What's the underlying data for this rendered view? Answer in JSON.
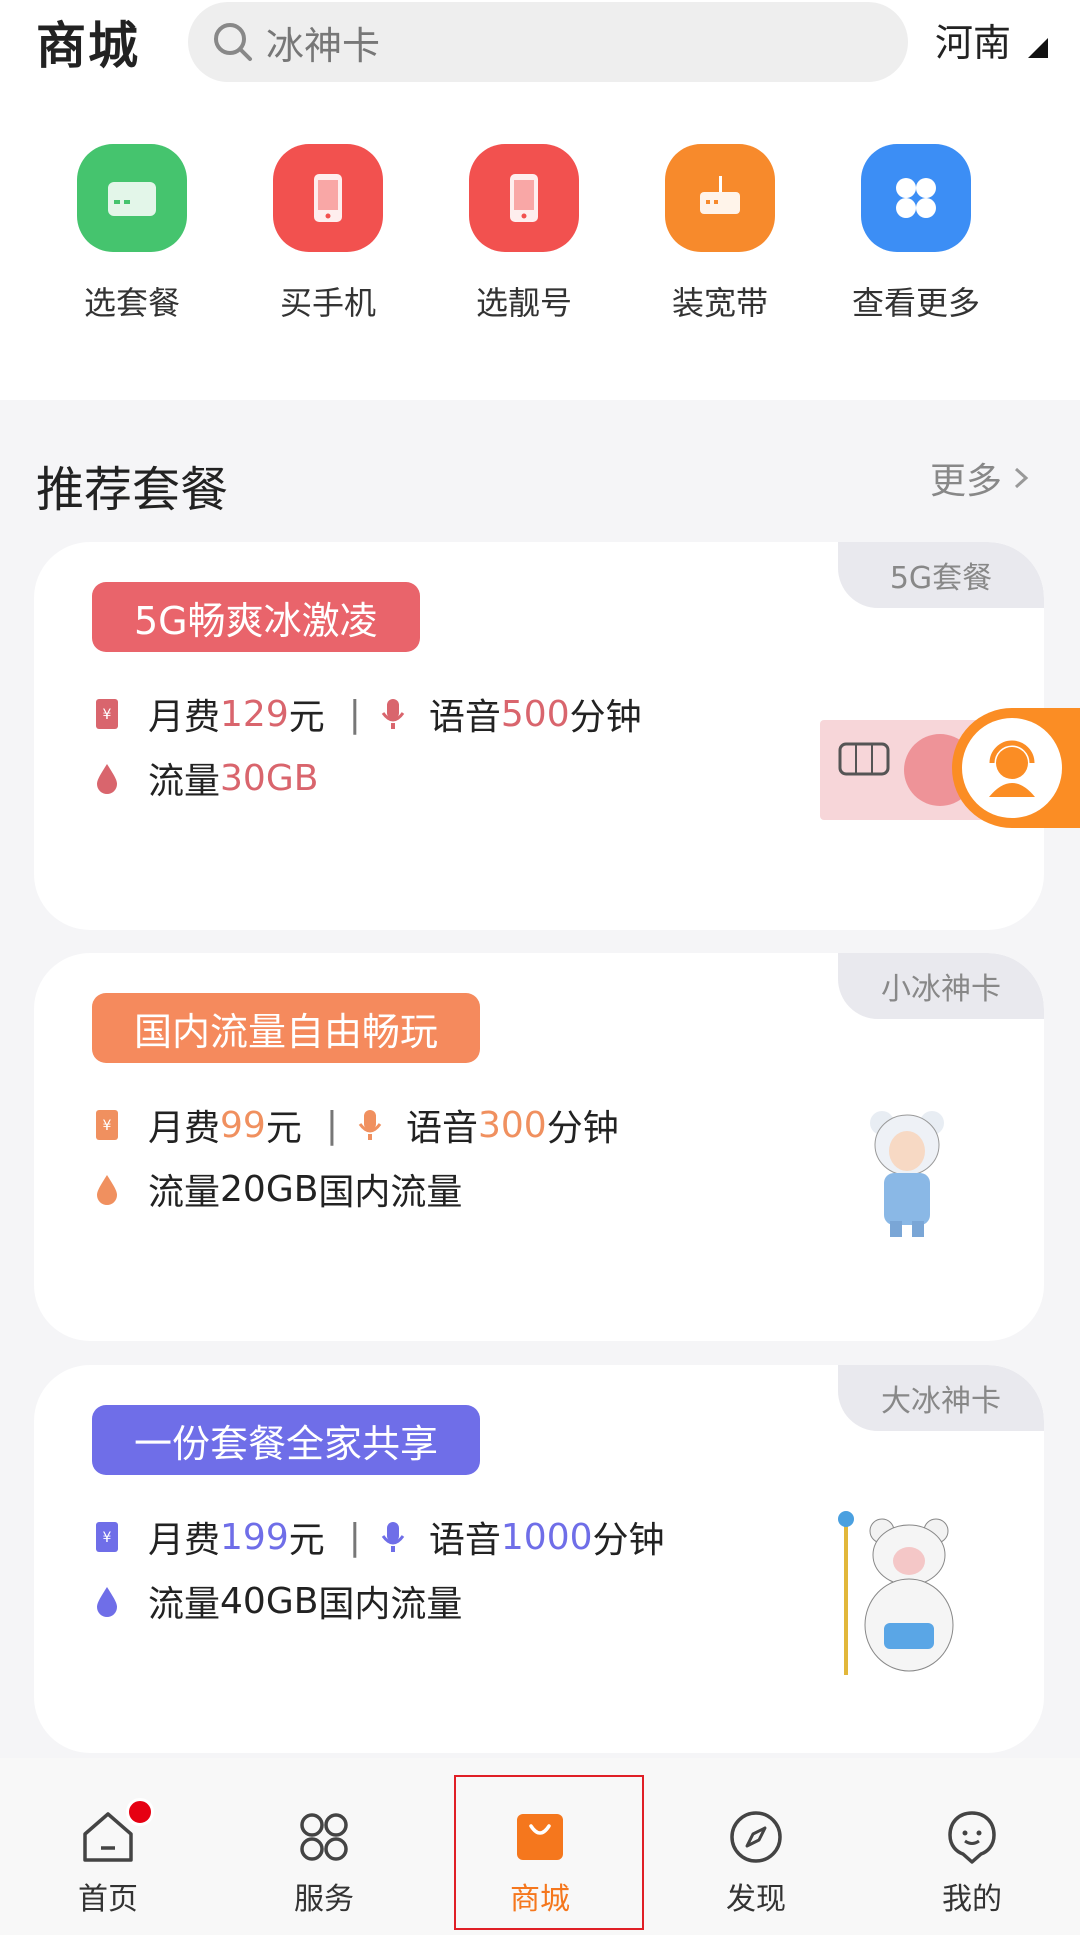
{
  "header": {
    "title": "商城",
    "search_placeholder": "冰神卡",
    "region": "河南"
  },
  "quick_links": [
    {
      "label": "选套餐",
      "icon": "card-icon",
      "color": "#45c46e"
    },
    {
      "label": "买手机",
      "icon": "phone-icon",
      "color": "#f2514f"
    },
    {
      "label": "选靓号",
      "icon": "number-icon",
      "color": "#f2514f"
    },
    {
      "label": "装宽带",
      "icon": "router-icon",
      "color": "#f78a2c"
    },
    {
      "label": "查看更多",
      "icon": "grid-icon",
      "color": "#3c8ef5"
    }
  ],
  "section": {
    "title": "推荐套餐",
    "more": "更多"
  },
  "plans": [
    {
      "tag": "5G套餐",
      "title": "5G畅爽冰激凌",
      "title_color": "#e9646b",
      "fee_label": "月费 ",
      "fee_value": "129",
      "fee_unit": "元",
      "voice_label": "语音",
      "voice_value": "500",
      "voice_unit": "分钟",
      "data_label": "流量",
      "data_value": "30GB",
      "data_suffix": "",
      "accent_color": "#d9656d"
    },
    {
      "tag": "小冰神卡",
      "title": "国内流量自由畅玩",
      "title_color": "#f58a5d",
      "fee_label": "月费 ",
      "fee_value": "99",
      "fee_unit": "元",
      "voice_label": "语音",
      "voice_value": "300",
      "voice_unit": "分钟",
      "data_label": "流量",
      "data_value": "20GB",
      "data_suffix": "国内流量",
      "accent_color": "#f0905f"
    },
    {
      "tag": "大冰神卡",
      "title": "一份套餐全家共享",
      "title_color": "#6f6ee8",
      "fee_label": "月费 ",
      "fee_value": "199",
      "fee_unit": "元",
      "voice_label": "语音",
      "voice_value": "1000",
      "voice_unit": "分钟",
      "data_label": "流量",
      "data_value": "40GB",
      "data_suffix": "国内流量",
      "accent_color": "#6f6ee8"
    }
  ],
  "bottom_nav": [
    {
      "label": "首页",
      "icon": "home-icon"
    },
    {
      "label": "服务",
      "icon": "services-icon"
    },
    {
      "label": "商城",
      "icon": "shop-bag-icon",
      "active": true
    },
    {
      "label": "发现",
      "icon": "compass-icon"
    },
    {
      "label": "我的",
      "icon": "profile-icon"
    }
  ]
}
